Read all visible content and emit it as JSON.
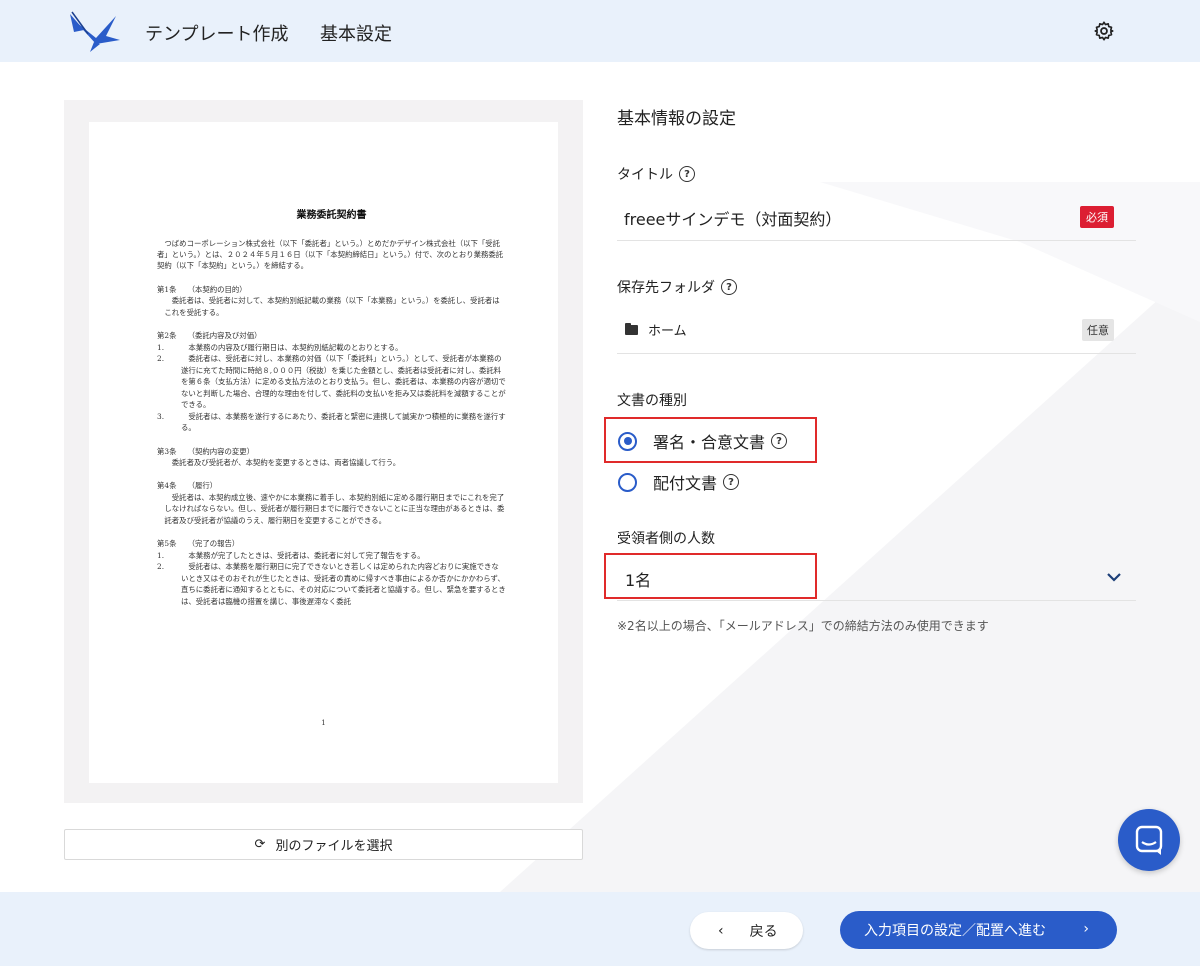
{
  "header": {
    "title": "テンプレート作成",
    "subtitle": "基本設定",
    "settings_icon": "gear-icon"
  },
  "preview": {
    "doc_title": "業務委託契約書",
    "intro": "つばめコーポレーション株式会社（以下「委託者」という。）とめだかデザイン株式会社（以下「受託者」という。）とは、２０２４年５月１６日（以下「本契約締結日」という。）付で、次のとおり業務委託契約（以下「本契約」という。）を締結する。",
    "articles": [
      {
        "heading": "第1条　　（本契約の目的）",
        "paragraphs": [
          "委託者は、受託者に対して、本契約別紙記載の業務（以下「本業務」という。）を委託し、受託者はこれを受託する。"
        ]
      },
      {
        "heading": "第2条　　（委託内容及び対価）",
        "items": [
          {
            "n": "1.",
            "t": "本業務の内容及び履行期日は、本契約別紙記載のとおりとする。"
          },
          {
            "n": "2.",
            "t": "委託者は、受託者に対し、本業務の対価（以下「委託料」という。）として、受託者が本業務の遂行に充てた時間に時給８,０００円（税抜）を乗じた金額とし、委託者は受託者に対し、委託料を第６条（支払方法）に定める支払方法のとおり支払う。但し、委託者は、本業務の内容が適切でないと判断した場合、合理的な理由を付して、委託料の支払いを拒み又は委託料を減額することができる。"
          },
          {
            "n": "3.",
            "t": "受託者は、本業務を遂行するにあたり、委託者と緊密に連携して誠実かつ積極的に業務を遂行する。"
          }
        ]
      },
      {
        "heading": "第3条　　（契約内容の変更）",
        "paragraphs": [
          "委託者及び受託者が、本契約を変更するときは、両者協議して行う。"
        ]
      },
      {
        "heading": "第4条　　（履行）",
        "paragraphs": [
          "受託者は、本契約成立後、速やかに本業務に着手し、本契約別紙に定める履行期日までにこれを完了しなければならない。但し、受託者が履行期日までに履行できないことに正当な理由があるときは、委託者及び受託者が協議のうえ、履行期日を変更することができる。"
        ]
      },
      {
        "heading": "第5条　　（完了の報告）",
        "items": [
          {
            "n": "1.",
            "t": "本業務が完了したときは、受託者は、委託者に対して完了報告をする。"
          },
          {
            "n": "2.",
            "t": "受託者は、本業務を履行期日に完了できないとき若しくは定められた内容どおりに実施できないとき又はそのおそれが生じたときは、受託者の責めに帰すべき事由によるか否かにかかわらず、直ちに委託者に通知するとともに、その対応について委託者と協議する。但し、緊急を要するときは、受託者は臨機の措置を講じ、事後遅滞なく委託"
          }
        ]
      }
    ],
    "page_number": "1"
  },
  "file_button": {
    "label": "別のファイルを選択",
    "icon": "refresh-icon"
  },
  "form": {
    "section_title": "基本情報の設定",
    "title_label": "タイトル",
    "title_value": "freeeサインデモ（対面契約）",
    "required_badge": "必須",
    "folder_label": "保存先フォルダ",
    "folder_value": "ホーム",
    "optional_badge": "任意",
    "doc_type_label": "文書の種別",
    "doc_type_options": [
      "署名・合意文書",
      "配付文書"
    ],
    "doc_type_selected": "署名・合意文書",
    "recipients_label": "受領者側の人数",
    "recipients_value": "1名",
    "recipients_note": "※2名以上の場合、「メールアドレス」での締結方法のみ使用できます"
  },
  "footer": {
    "back_label": "戻る",
    "next_label": "入力項目の設定／配置へ進む"
  },
  "colors": {
    "header_bg": "#e9f1fb",
    "primary": "#2a5cc9",
    "required": "#dc1e32",
    "highlight": "#e02a2a"
  }
}
